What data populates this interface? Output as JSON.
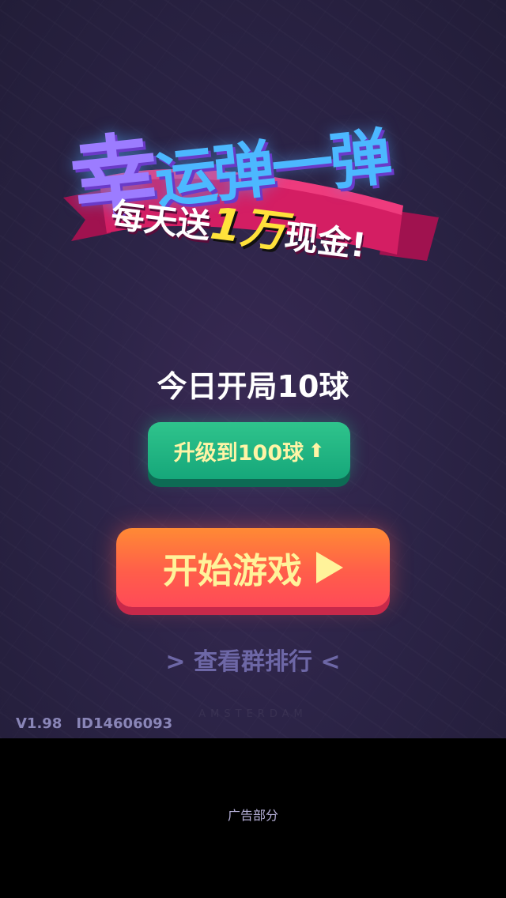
{
  "logo": {
    "title_first": "幸",
    "title_rest": "运弹一弹",
    "tagline_pre": "每天送",
    "tagline_highlight": "1万",
    "tagline_post": "现金!"
  },
  "today_text": "今日开局10球",
  "upgrade_button": {
    "label": "升级到100球",
    "icon": "up-arrow-icon"
  },
  "start_button": {
    "label": "开始游戏",
    "icon": "play-icon"
  },
  "rank_link": "> 查看群排行 <",
  "footer": {
    "version": "V1.98",
    "id": "ID14606093",
    "watermark": "AMSTERDAM"
  },
  "ad": {
    "label": "广告部分"
  },
  "colors": {
    "background": "#2c2447",
    "upgrade_green": "#1fb582",
    "start_orange": "#ff6a40",
    "button_text_yellow": "#fff39a",
    "link_purple": "#6d67a6"
  }
}
